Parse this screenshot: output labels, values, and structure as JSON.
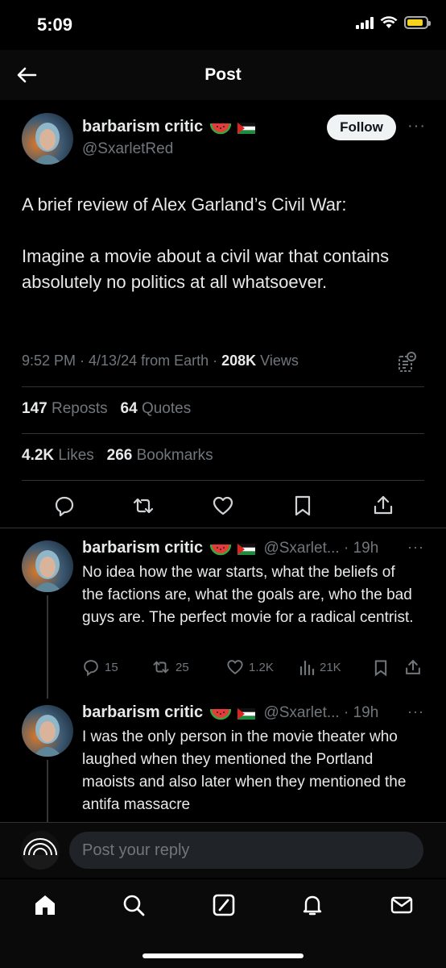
{
  "status_bar": {
    "time": "5:09",
    "battery_level": 0.85
  },
  "header": {
    "title": "Post"
  },
  "post": {
    "author_name": "barbarism critic",
    "author_handle": "@SxarletRed",
    "follow_label": "Follow",
    "paragraph_1": "A brief review of Alex Garland’s Civil War:",
    "paragraph_2": "Imagine a movie about a civil war that contains absolutely no politics at all whatsoever.",
    "time_date": "9:52 PM · 4/13/24 from Earth · ",
    "views_count": "208K",
    "views_label": " Views",
    "reposts_count": "147",
    "reposts_label": " Reposts",
    "quotes_count": "64",
    "quotes_label": " Quotes",
    "likes_count": "4.2K",
    "likes_label": " Likes",
    "bookmarks_count": "266",
    "bookmarks_label": " Bookmarks"
  },
  "replies": [
    {
      "author_name": "barbarism critic",
      "handle_time": "@Sxarlet... · 19h",
      "text": "No idea how the war starts, what the beliefs of the factions are, what the goals are, who the bad guys are. The perfect movie for a radical centrist.",
      "replies": "15",
      "reposts": "25",
      "likes": "1.2K",
      "views": "21K"
    },
    {
      "author_name": "barbarism critic",
      "handle_time": "@Sxarlet... · 19h",
      "text": "I was the only person in the movie theater who laughed when they mentioned the Portland maoists and also later when they mentioned the antifa massacre"
    }
  ],
  "composer": {
    "placeholder": "Post your reply"
  },
  "icons": {
    "back": "arrow-left-icon",
    "verified_emoji_1": "watermelon-icon",
    "verified_emoji_2": "palestine-flag-icon",
    "grok": "grok-icon",
    "reply": "comment-icon",
    "repost": "repost-icon",
    "like": "heart-icon",
    "bookmark": "bookmark-icon",
    "share": "share-icon",
    "views": "views-icon",
    "tabs": [
      "home-icon",
      "search-icon",
      "grok-icon",
      "notifications-icon",
      "messages-icon"
    ]
  },
  "colors": {
    "accent_text": "#e7e9ea",
    "muted": "#71767b",
    "battery": "#f6d31c"
  }
}
